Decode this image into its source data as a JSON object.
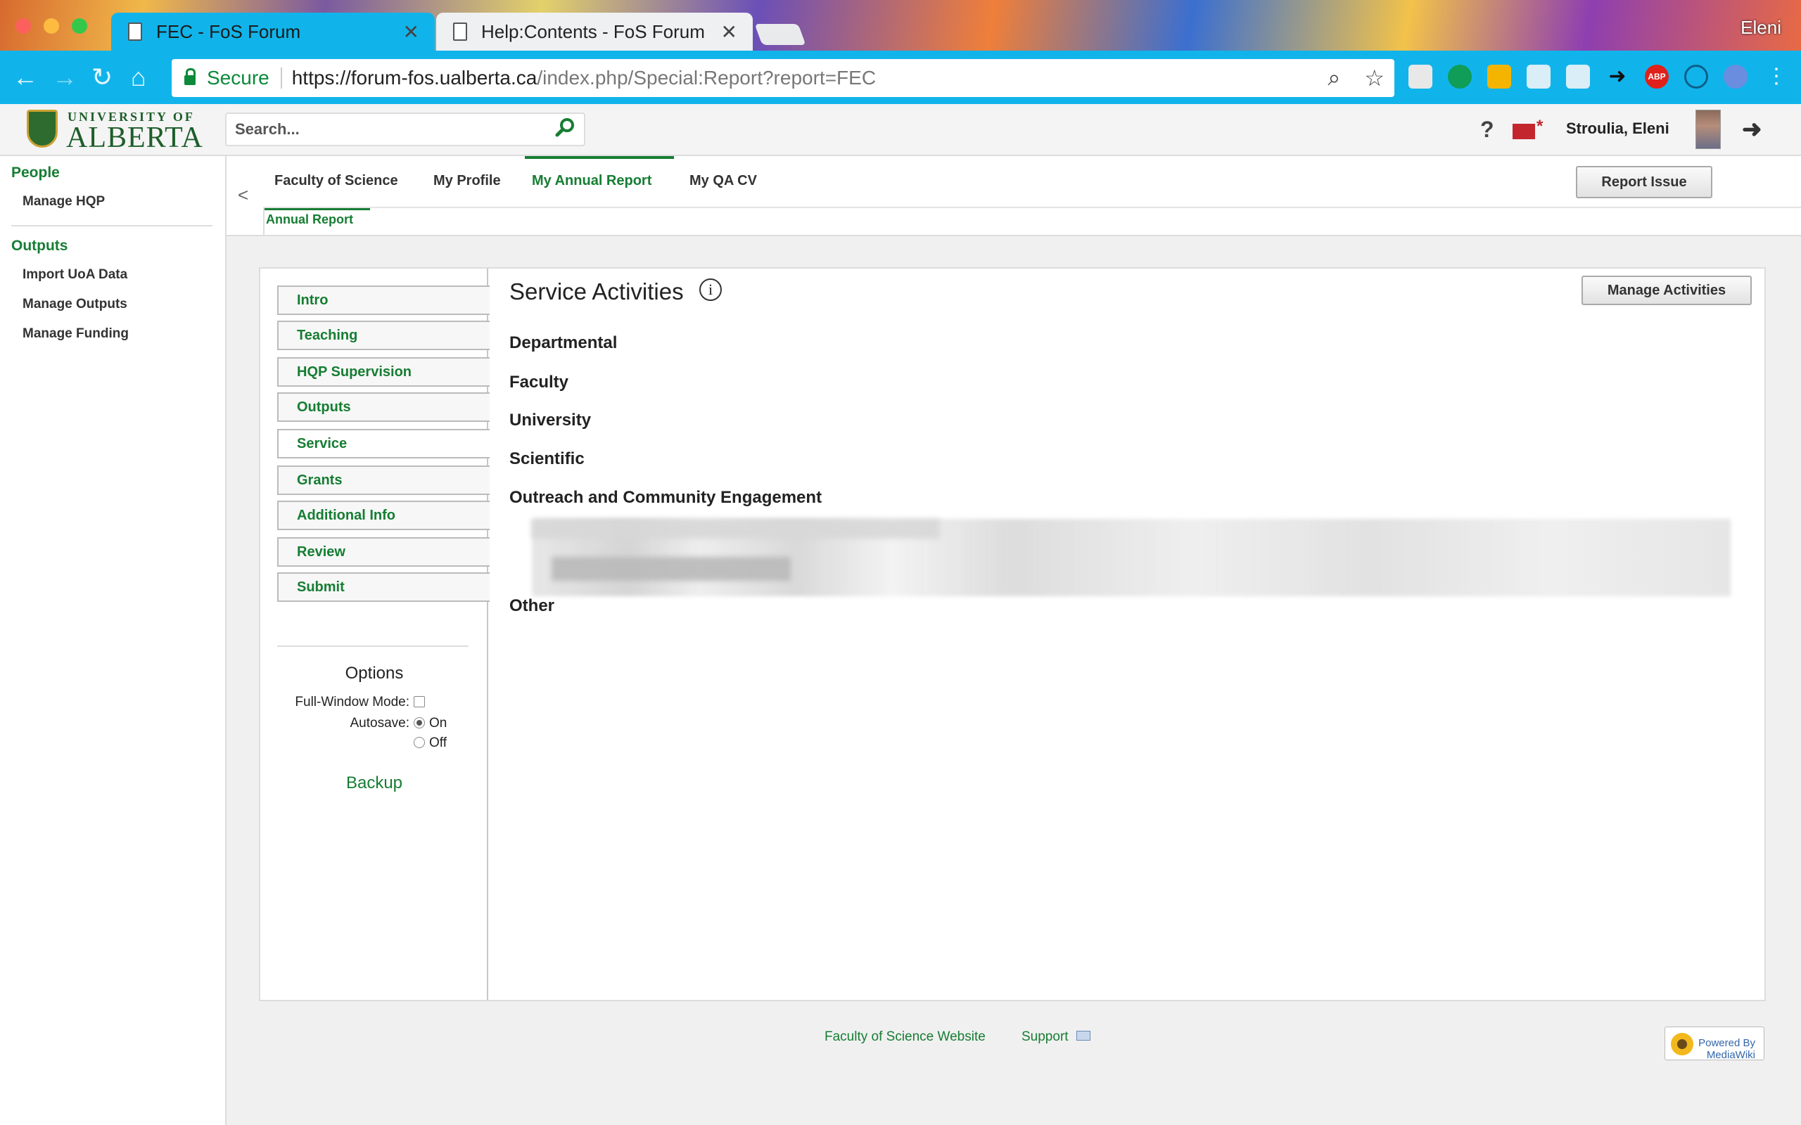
{
  "browser": {
    "tabs": [
      {
        "title": "FEC - FoS Forum",
        "active": true
      },
      {
        "title": "Help:Contents - FoS Forum",
        "active": false
      }
    ],
    "profile": "Eleni",
    "address": {
      "secure_label": "Secure",
      "scheme_host": "https://forum-fos.ualberta.ca",
      "path": "/index.php/Special:Report?report=FEC"
    },
    "extension_icons": [
      "cloud-icon",
      "hangouts-icon",
      "rss-icon",
      "cast-icon",
      "drive-icon",
      "share-icon",
      "adblock-icon",
      "eye-icon",
      "vpn-icon",
      "menu-icon"
    ],
    "accent_color": "#11b4ea"
  },
  "header": {
    "logo_top": "UNIVERSITY OF",
    "logo_main": "ALBERTA",
    "search_placeholder": "Search...",
    "help": "?",
    "mail_star": "*",
    "username": "Stroulia, Eleni",
    "brand_color": "#167d33"
  },
  "sidebar": {
    "sections": [
      {
        "heading": "People",
        "items": [
          "Manage HQP"
        ]
      },
      {
        "heading": "Outputs",
        "items": [
          "Import UoA Data",
          "Manage Outputs",
          "Manage Funding"
        ]
      }
    ]
  },
  "topnav": {
    "collapse": "<",
    "tabs": [
      {
        "label": "Faculty of Science",
        "active": false
      },
      {
        "label": "My Profile",
        "active": false
      },
      {
        "label": "My Annual Report",
        "active": true
      },
      {
        "label": "My QA CV",
        "active": false
      }
    ],
    "subtab": "Annual Report",
    "report_issue": "Report Issue"
  },
  "report": {
    "sections": [
      {
        "label": "Intro",
        "selected": false
      },
      {
        "label": "Teaching",
        "selected": false
      },
      {
        "label": "HQP Supervision",
        "selected": false
      },
      {
        "label": "Outputs",
        "selected": false
      },
      {
        "label": "Service",
        "selected": true
      },
      {
        "label": "Grants",
        "selected": false
      },
      {
        "label": "Additional Info",
        "selected": false
      },
      {
        "label": "Review",
        "selected": false
      },
      {
        "label": "Submit",
        "selected": false
      }
    ],
    "options": {
      "title": "Options",
      "full_window_label": "Full-Window Mode:",
      "full_window_checked": false,
      "autosave_label": "Autosave:",
      "autosave_on": "On",
      "autosave_off": "Off",
      "autosave_value": "On",
      "backup": "Backup"
    },
    "content": {
      "title": "Service Activities",
      "info_glyph": "i",
      "manage_button": "Manage Activities",
      "categories": [
        "Departmental",
        "Faculty",
        "University",
        "Scientific",
        "Outreach and Community Engagement",
        "Other"
      ]
    }
  },
  "footer": {
    "links": [
      "Faculty of Science Website",
      "Support"
    ],
    "badge": "Powered By MediaWiki"
  }
}
